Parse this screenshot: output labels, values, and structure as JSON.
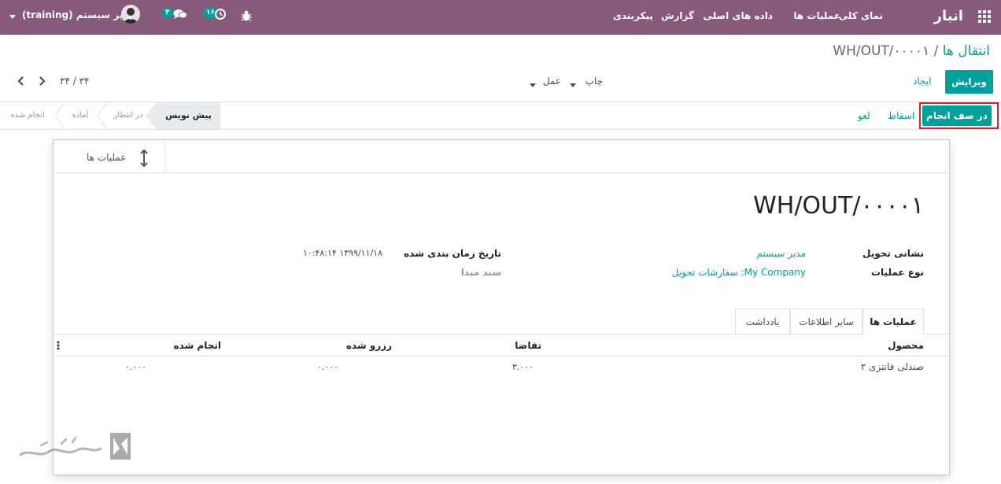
{
  "navbar": {
    "app_title": "انبار",
    "menu": [
      "نمای کلی",
      "عملیات ها",
      "داده های اصلی",
      "گزارش",
      "پیکربندی"
    ],
    "activity_count": "۱۶",
    "message_count": "۳",
    "user_name": "مدیر سیستم (training)"
  },
  "breadcrumb": {
    "parent": "انتقال ها",
    "separator": " / ",
    "current": "WH/OUT/۰۰۰۰۱"
  },
  "toolbar": {
    "edit_label": "ویرایش",
    "create_label": "ایجاد",
    "print_label": "چاپ",
    "action_label": "عمل",
    "pager_value": "۳۴ / ۳۴"
  },
  "statusbar": {
    "buttons": {
      "mark_todo": "در صف انجام",
      "scrap": "اسقاط",
      "cancel": "لغو"
    },
    "stages": [
      "پیش نویس",
      "در انتظار",
      "آماده",
      "انجام شده"
    ]
  },
  "sheet": {
    "smart_button_label": "عملیات ها",
    "title": "WH/OUT/۰۰۰۰۱",
    "fields": {
      "delivery_address_label": "نشانی تحویل",
      "delivery_address_value": "مدیر سیستم",
      "operation_type_label": "نوع عملیات",
      "operation_type_value": "My Company: سفارشات تحویل",
      "scheduled_date_label": "تاریخ زمان بندی شده",
      "scheduled_date_value": "۱۳۹۹/۱۱/۱۸ ۱۰:۴۸:۱۴",
      "source_document_label": "سند مبدا"
    },
    "tabs": [
      "عملیات ها",
      "سایر اطلاعات",
      "یادداشت"
    ],
    "table": {
      "headers": [
        "محصول",
        "تقاضا",
        "رزرو شده",
        "انجام شده"
      ],
      "rows": [
        [
          "صندلی فانتزی ۲",
          "۳.۰۰۰",
          "۰.۰۰۰",
          "۰.۰۰۰"
        ]
      ]
    }
  },
  "colors": {
    "navbar": "#875a7b",
    "primary": "#00a09d",
    "highlight": "#e02020"
  }
}
